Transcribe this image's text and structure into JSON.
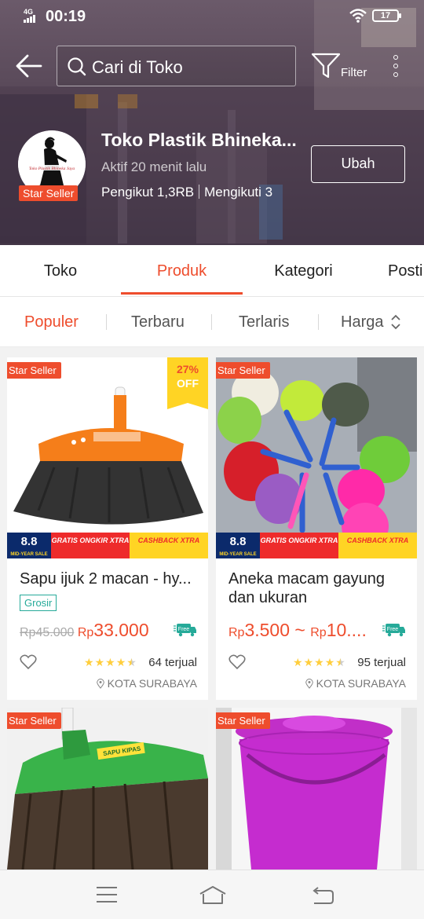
{
  "status_bar": {
    "network": "4G",
    "time": "00:19",
    "battery": "17"
  },
  "header": {
    "search_placeholder": "Cari di Toko",
    "filter_label": "Filter"
  },
  "shop": {
    "name": "Toko Plastik Bhineka...",
    "badge": "Star Seller",
    "active": "Aktif 20 menit lalu",
    "followers": "Pengikut 1,3RB",
    "following": "Mengikuti 3",
    "edit_label": "Ubah"
  },
  "tabs": [
    {
      "label": "Toko",
      "active": false
    },
    {
      "label": "Produk",
      "active": true
    },
    {
      "label": "Kategori",
      "active": false
    },
    {
      "label": "Posti",
      "active": false
    }
  ],
  "sort": [
    {
      "label": "Populer",
      "active": true
    },
    {
      "label": "Terbaru",
      "active": false
    },
    {
      "label": "Terlaris",
      "active": false
    },
    {
      "label": "Harga",
      "active": false
    }
  ],
  "products": [
    {
      "badge": "Star Seller",
      "discount_pct": "27%",
      "discount_off": "OFF",
      "promo_88": "8.8",
      "promo_88_sub": "MID-YEAR SALE",
      "promo_gratis": "GRATIS ONGKIR XTRA",
      "promo_cashback": "CASHBACK XTRA",
      "title": "Sapu ijuk 2 macan - hy...",
      "tag": "Grosir",
      "price_old": "Rp45.000",
      "price_prefix": "Rp",
      "price": "33.000",
      "ship_label": "Free",
      "rating": 4.5,
      "sold": "64 terjual",
      "location": "KOTA SURABAYA"
    },
    {
      "badge": "Star Seller",
      "promo_88": "8.8",
      "promo_88_sub": "MID-YEAR SALE",
      "promo_gratis": "GRATIS ONGKIR XTRA",
      "promo_cashback": "CASHBACK XTRA",
      "title": "Aneka macam gayung dan ukuran",
      "price_prefix": "Rp",
      "price": "3.500",
      "price_range_sep": " ~ ",
      "price_prefix_2": "Rp",
      "price_max": "10....",
      "ship_label": "Free",
      "rating": 4.5,
      "sold": "95 terjual",
      "location": "KOTA SURABAYA"
    },
    {
      "badge": "Star Seller",
      "image_text": "SAPU KIPAS"
    },
    {
      "badge": "Star Seller"
    }
  ],
  "colors": {
    "accent": "#ee4d2d",
    "star": "#ffce3d",
    "teal": "#26aa99"
  },
  "icons": [
    "back-arrow-icon",
    "search-icon",
    "filter-icon",
    "more-vertical-icon",
    "heart-icon",
    "free-shipping-icon",
    "location-pin-icon",
    "menu-icon",
    "home-icon",
    "return-icon"
  ]
}
